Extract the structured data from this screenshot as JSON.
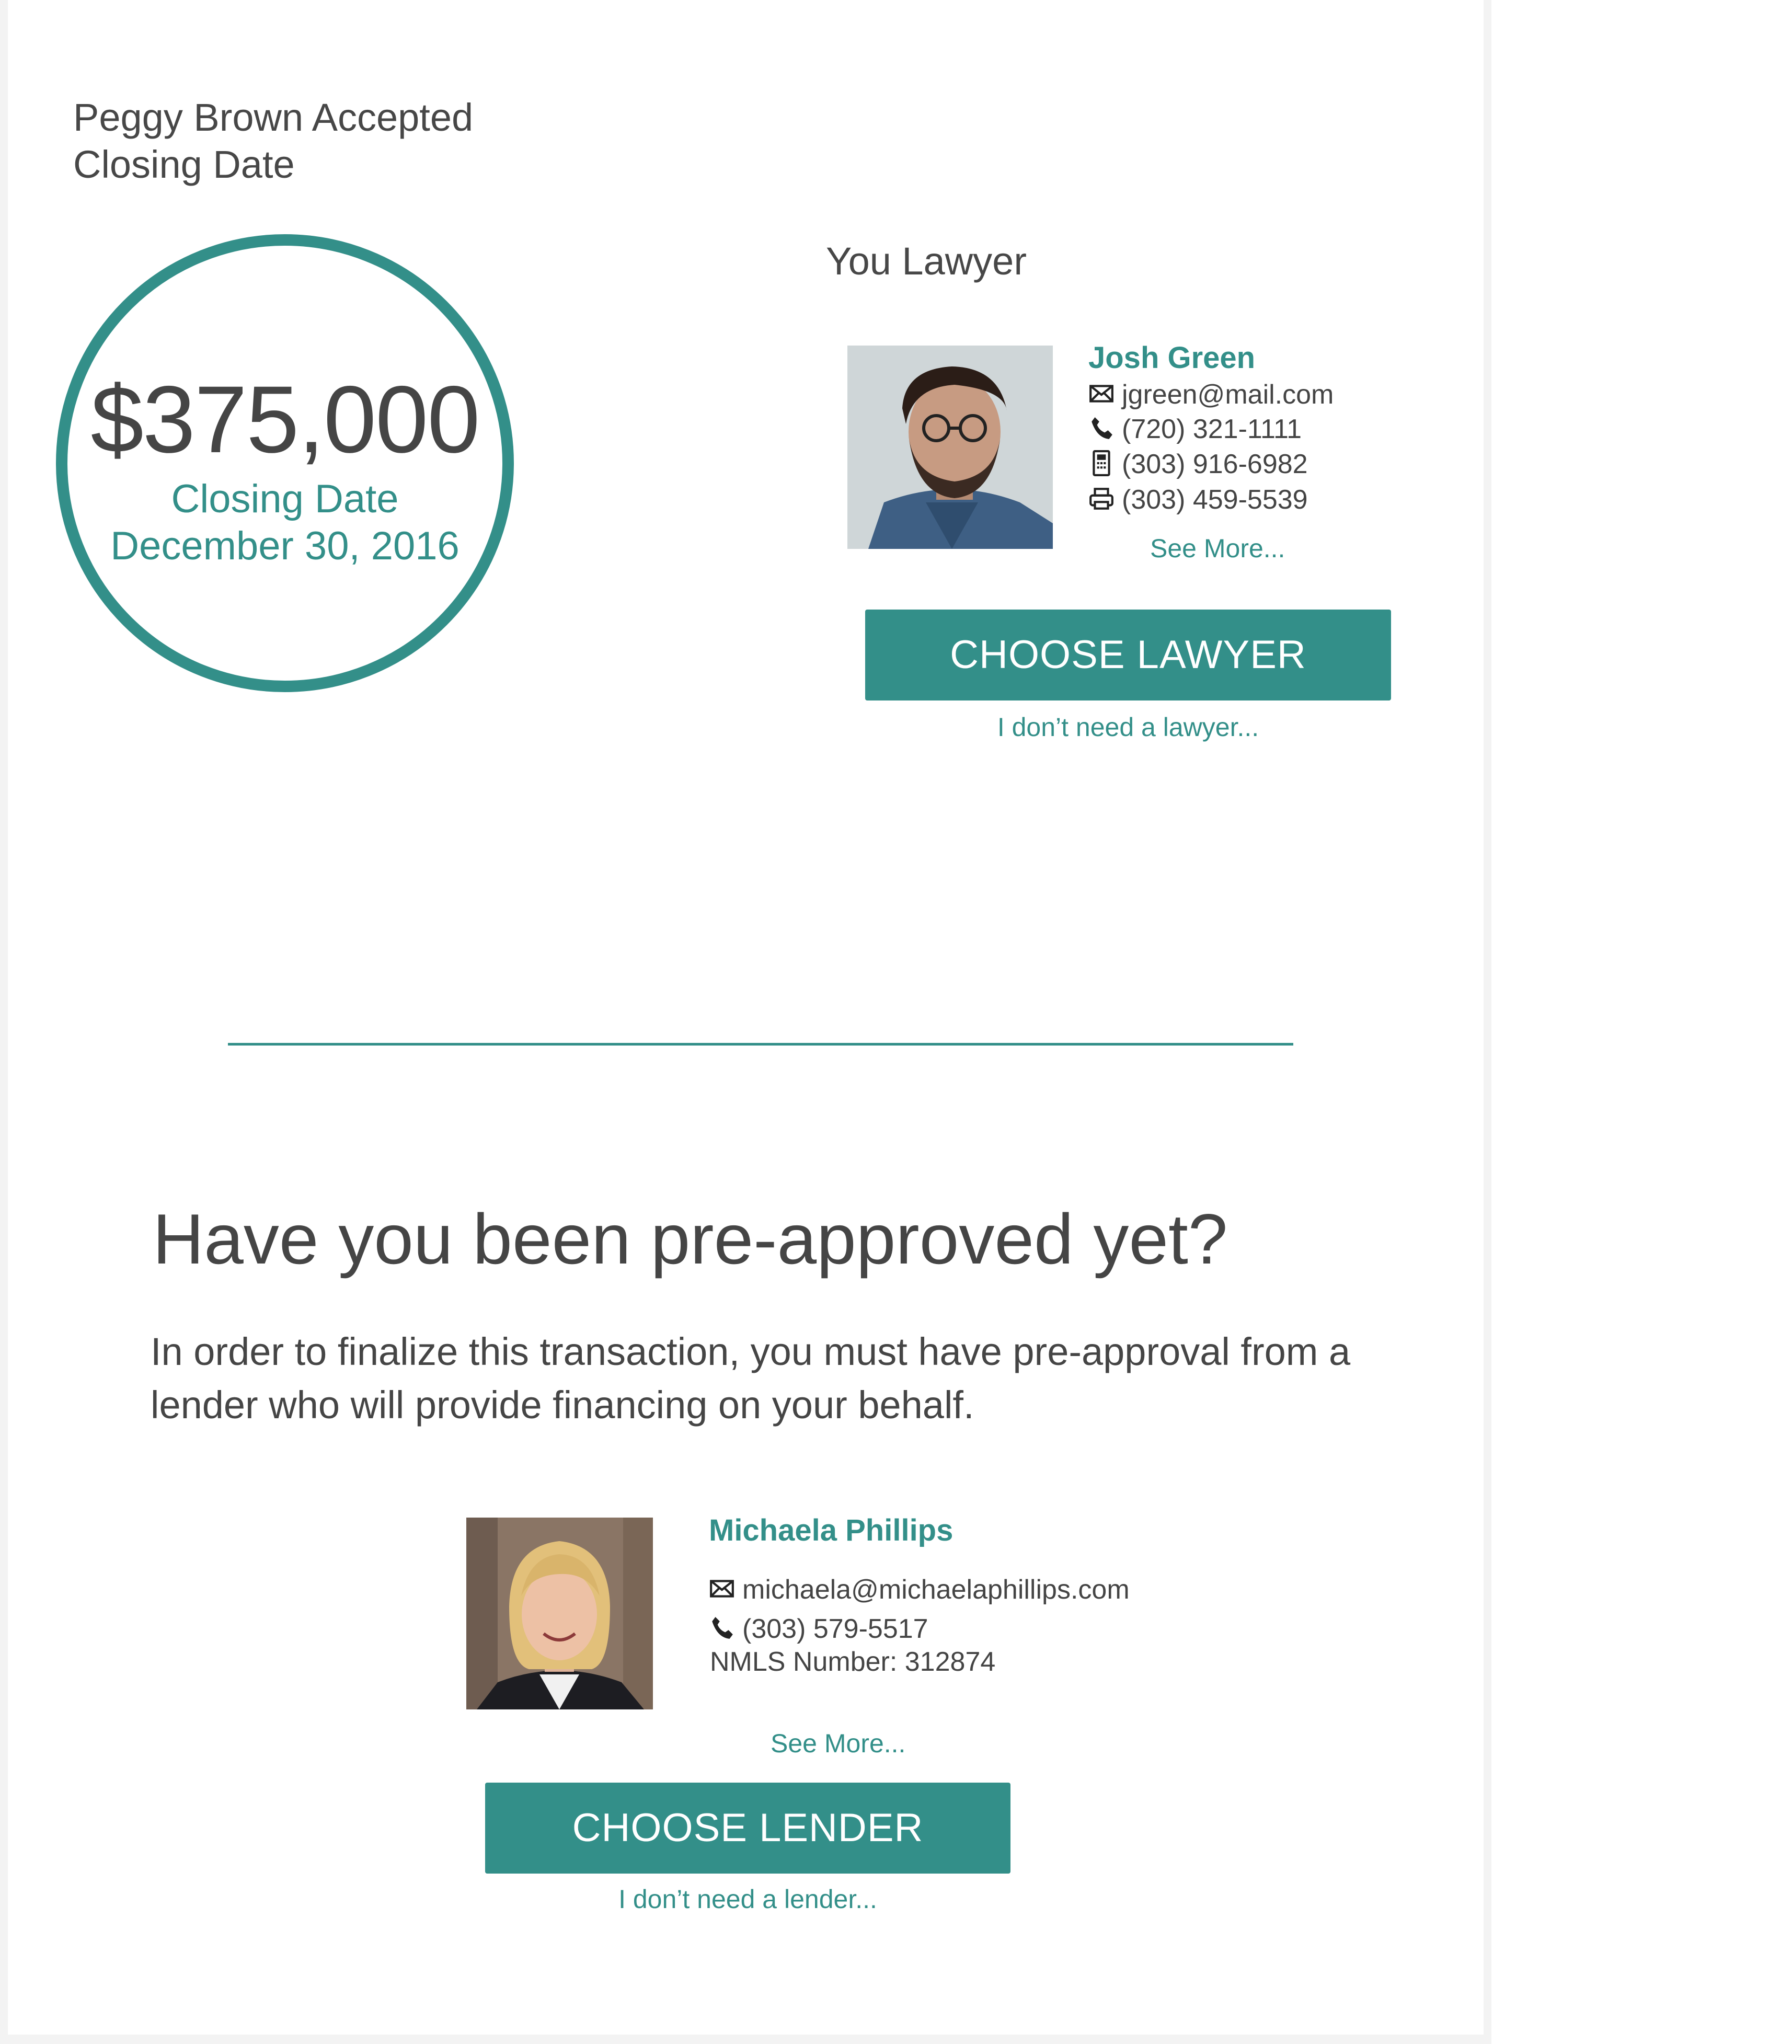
{
  "header": {
    "title_line1": "Peggy Brown Accepted",
    "title_line2": "Closing Date"
  },
  "summary": {
    "price": "$375,000",
    "closing_label": "Closing Date",
    "closing_date": "December 30, 2016"
  },
  "lawyer": {
    "heading": "You Lawyer",
    "name": "Josh Green",
    "email": "jgreen@mail.com",
    "phone": "(720) 321-1111",
    "mobile": "(303) 916-6982",
    "fax": "(303) 459-5539",
    "see_more": "See More...",
    "choose_label": "CHOOSE LAWYER",
    "decline_label": "I don’t need a lawyer..."
  },
  "preapproval": {
    "heading": "Have you been pre-approved yet?",
    "text": "In order to finalize this transaction, you must have pre-approval from a lender who will provide financing on your behalf."
  },
  "lender": {
    "name": "Michaela Phillips",
    "email": "michaela@michaelaphillips.com",
    "phone": "(303) 579-5517",
    "nmls": "NMLS Number: 312874",
    "see_more": "See More...",
    "choose_label": "CHOOSE LENDER",
    "decline_label": "I don’t need a lender..."
  },
  "theme": {
    "accent": "#338f89",
    "text": "#474747",
    "frame": "#f3f3f3"
  },
  "icons": [
    "envelope-icon",
    "phone-icon",
    "mobile-phone-icon",
    "fax-icon"
  ]
}
